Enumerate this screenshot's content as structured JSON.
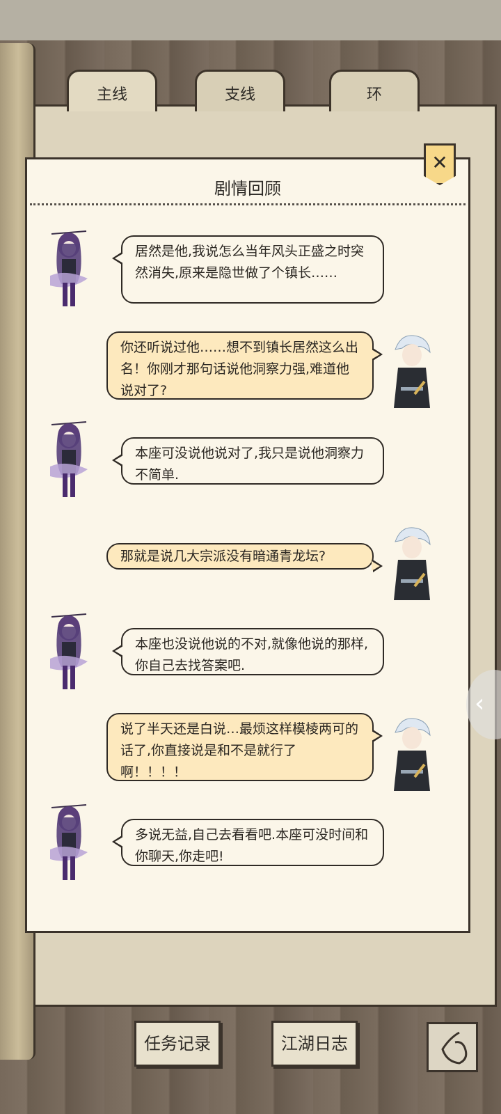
{
  "tabs": [
    {
      "label": "主线",
      "active": true
    },
    {
      "label": "支线",
      "active": false
    },
    {
      "label": "环",
      "active": false
    }
  ],
  "panel": {
    "title": "剧情回顾",
    "close_icon": "close-icon"
  },
  "dialogue": [
    {
      "speaker": "purple-hair-woman",
      "side": "left",
      "text": "居然是他,我说怎么当年风头正盛之时突然消失,原来是隐世做了个镇长……"
    },
    {
      "speaker": "white-hair-swordsman",
      "side": "right",
      "text": "你还听说过他……想不到镇长居然这么出名！你刚才那句话说他洞察力强,难道他说对了?"
    },
    {
      "speaker": "purple-hair-woman",
      "side": "left",
      "text": "本座可没说他说对了,我只是说他洞察力不简单."
    },
    {
      "speaker": "white-hair-swordsman",
      "side": "right",
      "text": "那就是说几大宗派没有暗通青龙坛?"
    },
    {
      "speaker": "purple-hair-woman",
      "side": "left",
      "text": "本座也没说他说的不对,就像他说的那样,你自己去找答案吧."
    },
    {
      "speaker": "white-hair-swordsman",
      "side": "right",
      "text": "说了半天还是白说…最烦这样模棱两可的话了,你直接说是和不是就行了啊！！！！"
    },
    {
      "speaker": "purple-hair-woman",
      "side": "left",
      "text": "多说无益,自己去看看吧.本座可没时间和你聊天,你走吧!"
    }
  ],
  "bottom": {
    "task_record": "任务记录",
    "jianghu_log": "江湖日志",
    "back_icon": "back-icon"
  },
  "side_nav_icon": "chevron-left-icon",
  "colors": {
    "paper": "#fbf6e9",
    "right_bubble": "#fde9be",
    "close_button": "#f7d889",
    "outline": "#3b332b"
  }
}
